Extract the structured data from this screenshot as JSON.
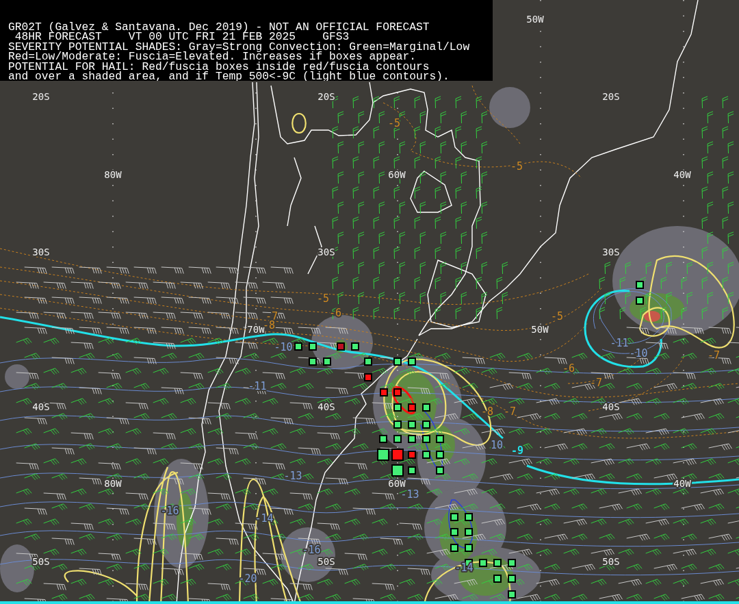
{
  "header": {
    "lines": [
      "GR02T (Galvez & Santavana. Dec 2019) - NOT AN OFFICIAL FORECAST",
      " 48HR FORECAST    VT 00 UTC FRI 21 FEB 2025    GFS3",
      "SEVERITY POTENTIAL SHADES: Gray=Strong Convection: Green=Marginal/Low",
      "Red=Low/Moderate: Fuscia=Elevated. Increases if boxes appear.",
      "POTENTIAL FOR HAIL: Red/fuscia boxes inside red/fuscia contours",
      "and over a shaded area, and if Temp 500<-9C (light blue contours)."
    ]
  },
  "grid_labels": [
    "50W",
    "20S",
    "20S",
    "20S",
    "80W",
    "60W",
    "40W",
    "30S",
    "30S",
    "30S",
    "70W",
    "50W",
    "40S",
    "40S",
    "40S",
    "80W",
    "60W",
    "40W",
    "50S",
    "50S",
    "50S"
  ],
  "contour_labels": [
    {
      "text": "-5",
      "kind": "temperature"
    },
    {
      "text": "-5",
      "kind": "temperature"
    },
    {
      "text": "-5",
      "kind": "temperature"
    },
    {
      "text": "-6",
      "kind": "temperature"
    },
    {
      "text": "-7",
      "kind": "temperature"
    },
    {
      "text": "-5",
      "kind": "temperature"
    },
    {
      "text": "-8",
      "kind": "temperature"
    },
    {
      "text": "-7",
      "kind": "temperature"
    },
    {
      "text": "-6",
      "kind": "temperature"
    },
    {
      "text": "-7",
      "kind": "temperature"
    },
    {
      "text": "-8",
      "kind": "temperature"
    },
    {
      "text": "-7",
      "kind": "temperature"
    },
    {
      "text": "-10",
      "kind": "cold"
    },
    {
      "text": "-11",
      "kind": "cold"
    },
    {
      "text": "-13",
      "kind": "cold"
    },
    {
      "text": "-14",
      "kind": "cold"
    },
    {
      "text": "-16",
      "kind": "cold"
    },
    {
      "text": "-16",
      "kind": "cold"
    },
    {
      "text": "-20",
      "kind": "cold"
    },
    {
      "text": "-11",
      "kind": "cold"
    },
    {
      "text": "-10",
      "kind": "cold"
    },
    {
      "text": "10",
      "kind": "cold"
    },
    {
      "text": "-13",
      "kind": "cold"
    },
    {
      "text": "-14",
      "kind": "cold"
    },
    {
      "text": "-9",
      "kind": "threshold"
    }
  ],
  "markers": [
    {
      "kind": "small",
      "color": "#44ee77"
    },
    {
      "kind": "small",
      "color": "#44ee77"
    },
    {
      "kind": "small",
      "color": "#bb1122"
    },
    {
      "kind": "small",
      "color": "#44ee77"
    },
    {
      "kind": "small",
      "color": "#44ee77"
    },
    {
      "kind": "small",
      "color": "#44ee77"
    },
    {
      "kind": "small",
      "color": "#44ee77"
    },
    {
      "kind": "small",
      "color": "#ff1111"
    },
    {
      "kind": "small",
      "color": "#44ee77"
    },
    {
      "kind": "small",
      "color": "#44ee77"
    },
    {
      "kind": "small",
      "color": "#44ee77"
    },
    {
      "kind": "small",
      "color": "#44ee77"
    },
    {
      "kind": "small",
      "color": "#ff1111"
    },
    {
      "kind": "small",
      "color": "#ff1111"
    },
    {
      "kind": "small",
      "color": "#44ee77"
    },
    {
      "kind": "small",
      "color": "#ff1111"
    },
    {
      "kind": "small",
      "color": "#44ee77"
    },
    {
      "kind": "small",
      "color": "#44ee77"
    },
    {
      "kind": "small",
      "color": "#44ee77"
    },
    {
      "kind": "small",
      "color": "#44ee77"
    },
    {
      "kind": "small",
      "color": "#44ee77"
    },
    {
      "kind": "small",
      "color": "#44ee77"
    },
    {
      "kind": "small",
      "color": "#44ee77"
    },
    {
      "kind": "small",
      "color": "#44ee77"
    },
    {
      "kind": "small",
      "color": "#44ee77"
    },
    {
      "kind": "large",
      "color": "#44ee77"
    },
    {
      "kind": "large",
      "color": "#ff1111"
    },
    {
      "kind": "small",
      "color": "#ff1111"
    },
    {
      "kind": "small",
      "color": "#44ee77"
    },
    {
      "kind": "small",
      "color": "#44ee77"
    },
    {
      "kind": "large",
      "color": "#44ee77"
    },
    {
      "kind": "small",
      "color": "#44ee77"
    },
    {
      "kind": "small",
      "color": "#44ee77"
    },
    {
      "kind": "small",
      "color": "#44ee77"
    },
    {
      "kind": "small",
      "color": "#44ee77"
    },
    {
      "kind": "small",
      "color": "#44ee77"
    },
    {
      "kind": "small",
      "color": "#44ee77"
    },
    {
      "kind": "small",
      "color": "#44ee77"
    },
    {
      "kind": "small",
      "color": "#44ee77"
    },
    {
      "kind": "small",
      "color": "#44ee77"
    },
    {
      "kind": "small",
      "color": "#44ee77"
    },
    {
      "kind": "small",
      "color": "#44ee77"
    },
    {
      "kind": "small",
      "color": "#44ee77"
    },
    {
      "kind": "small",
      "color": "#44ee77"
    },
    {
      "kind": "small",
      "color": "#44ee77"
    },
    {
      "kind": "small",
      "color": "#44ee77"
    }
  ]
}
